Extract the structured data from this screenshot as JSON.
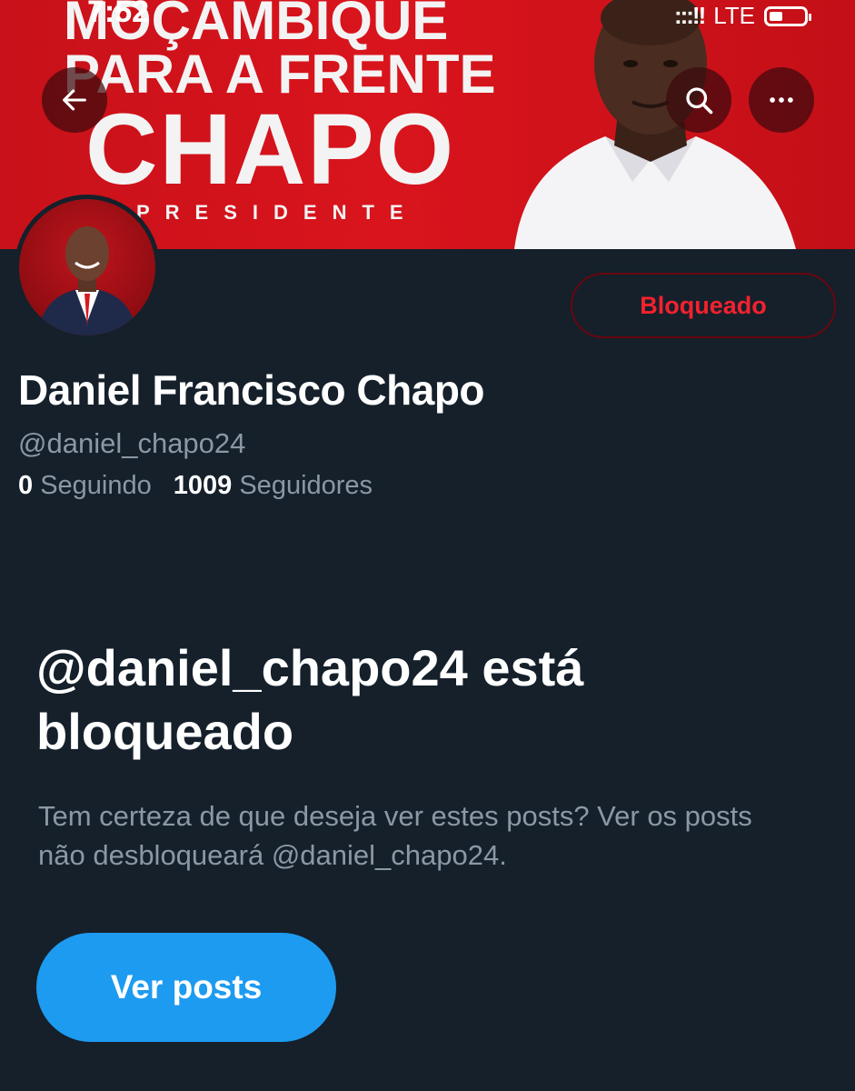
{
  "status_bar": {
    "time": "7:52",
    "signal": ":::!!",
    "network": "LTE"
  },
  "banner": {
    "line1": "Moçambique",
    "line2": "Para a Frente",
    "line3": "Chapo",
    "line4": "Presidente"
  },
  "header": {
    "back_icon": "arrow-left-icon",
    "search_icon": "search-icon",
    "more_icon": "more-horizontal-icon"
  },
  "profile": {
    "display_name": "Daniel Francisco Chapo",
    "handle": "@daniel_chapo24",
    "following_count": "0",
    "following_label": "Seguindo",
    "followers_count": "1009",
    "followers_label": "Seguidores",
    "block_button_label": "Bloqueado"
  },
  "blocked_notice": {
    "title": "@daniel_chapo24 está bloqueado",
    "description": "Tem certeza de que deseja ver estes posts? Ver os posts não desbloqueará @daniel_chapo24.",
    "button_label": "Ver posts"
  },
  "colors": {
    "background": "#15202b",
    "banner_red": "#d9141c",
    "blocked_red": "#f4212e",
    "primary_blue": "#1d9bf0",
    "secondary_text": "#8b98a5"
  }
}
